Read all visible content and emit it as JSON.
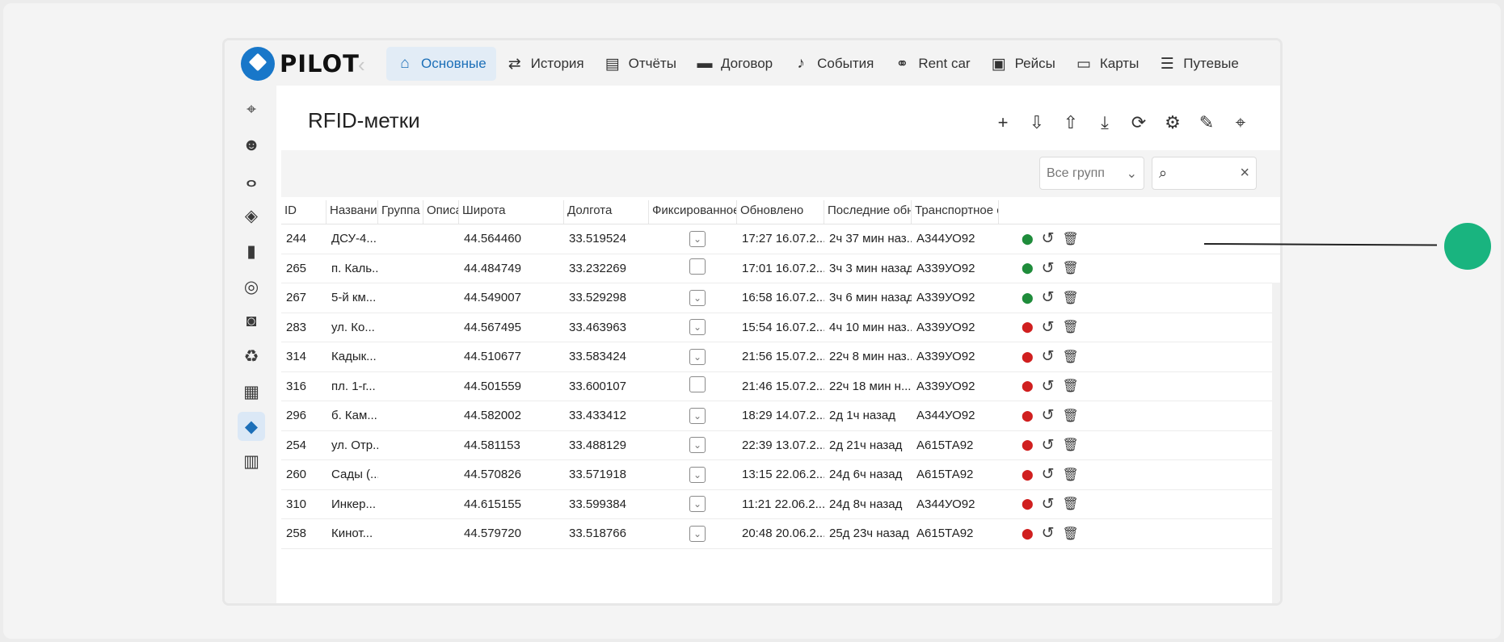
{
  "app": {
    "logo_text": "PILOT",
    "title": "RFID-метки"
  },
  "nav": [
    {
      "label": "Основные",
      "icon": "home-icon",
      "active": true
    },
    {
      "label": "История",
      "icon": "route-history-icon"
    },
    {
      "label": "Отчёты",
      "icon": "document-icon"
    },
    {
      "label": "Договор",
      "icon": "wallet-icon"
    },
    {
      "label": "События",
      "icon": "bell-icon"
    },
    {
      "label": "Rent car",
      "icon": "handshake-icon"
    },
    {
      "label": "Рейсы",
      "icon": "bus-icon"
    },
    {
      "label": "Карты",
      "icon": "card-icon"
    },
    {
      "label": "Путевые",
      "icon": "list-icon"
    }
  ],
  "sidebar": [
    {
      "icon": "map-marker-icon"
    },
    {
      "icon": "users-icon"
    },
    {
      "icon": "route-icon"
    },
    {
      "icon": "layers-icon"
    },
    {
      "icon": "bookmark-icon"
    },
    {
      "icon": "steering-wheel-icon"
    },
    {
      "icon": "fuel-gauge-icon"
    },
    {
      "icon": "recycle-icon"
    },
    {
      "icon": "calendar-icon"
    },
    {
      "icon": "tags-icon",
      "active": true
    },
    {
      "icon": "trailer-icon"
    }
  ],
  "filters": {
    "group_select": "Все групп",
    "search_placeholder": ""
  },
  "table": {
    "columns": [
      "ID",
      "Название",
      "Группа",
      "Описа",
      "Широта",
      "Долгота",
      "Фиксированное",
      "Обновлено",
      "Последние обно",
      "Транспортное ср"
    ],
    "rows": [
      {
        "id": "244",
        "name": "ДСУ-4...",
        "lat": "44.564460",
        "lon": "33.519524",
        "fixed": true,
        "updated": "17:27 16.07.2...",
        "last": "2ч 37 мин наз...",
        "vehicle": "А344УО92",
        "pin": "green"
      },
      {
        "id": "265",
        "name": "п. Каль...",
        "lat": "44.484749",
        "lon": "33.232269",
        "fixed": false,
        "updated": "17:01 16.07.2...",
        "last": "3ч 3 мин назад",
        "vehicle": "А339УО92",
        "pin": "green"
      },
      {
        "id": "267",
        "name": "5-й км...",
        "lat": "44.549007",
        "lon": "33.529298",
        "fixed": true,
        "updated": "16:58 16.07.2...",
        "last": "3ч 6 мин назад",
        "vehicle": "А339УО92",
        "pin": "green"
      },
      {
        "id": "283",
        "name": "ул. Ко...",
        "lat": "44.567495",
        "lon": "33.463963",
        "fixed": true,
        "updated": "15:54 16.07.2...",
        "last": "4ч 10 мин наз...",
        "vehicle": "А339УО92",
        "pin": "red"
      },
      {
        "id": "314",
        "name": "Кадык...",
        "lat": "44.510677",
        "lon": "33.583424",
        "fixed": true,
        "updated": "21:56 15.07.2...",
        "last": "22ч 8 мин наз...",
        "vehicle": "А339УО92",
        "pin": "red"
      },
      {
        "id": "316",
        "name": "пл. 1-г...",
        "lat": "44.501559",
        "lon": "33.600107",
        "fixed": false,
        "updated": "21:46 15.07.2...",
        "last": "22ч 18 мин н...",
        "vehicle": "А339УО92",
        "pin": "red"
      },
      {
        "id": "296",
        "name": "б. Кам...",
        "lat": "44.582002",
        "lon": "33.433412",
        "fixed": true,
        "updated": "18:29 14.07.2...",
        "last": "2д 1ч назад",
        "vehicle": "А344УО92",
        "pin": "red"
      },
      {
        "id": "254",
        "name": "ул. Отр...",
        "lat": "44.581153",
        "lon": "33.488129",
        "fixed": true,
        "updated": "22:39 13.07.2...",
        "last": "2д 21ч назад",
        "vehicle": "А615ТА92",
        "pin": "red"
      },
      {
        "id": "260",
        "name": "Сады (...",
        "lat": "44.570826",
        "lon": "33.571918",
        "fixed": true,
        "updated": "13:15 22.06.2...",
        "last": "24д 6ч назад",
        "vehicle": "А615ТА92",
        "pin": "red"
      },
      {
        "id": "310",
        "name": "Инкер...",
        "lat": "44.615155",
        "lon": "33.599384",
        "fixed": true,
        "updated": "11:21 22.06.2...",
        "last": "24д 8ч назад",
        "vehicle": "А344УО92",
        "pin": "red"
      },
      {
        "id": "258",
        "name": "Кинот...",
        "lat": "44.579720",
        "lon": "33.518766",
        "fixed": true,
        "updated": "20:48 20.06.2...",
        "last": "25д 23ч назад",
        "vehicle": "А615ТА92",
        "pin": "red"
      }
    ]
  },
  "colors": {
    "accent": "#1c6fb8",
    "pin_green": "#1f8c3b",
    "pin_red": "#d01f1f",
    "callout": "#19b47f"
  }
}
